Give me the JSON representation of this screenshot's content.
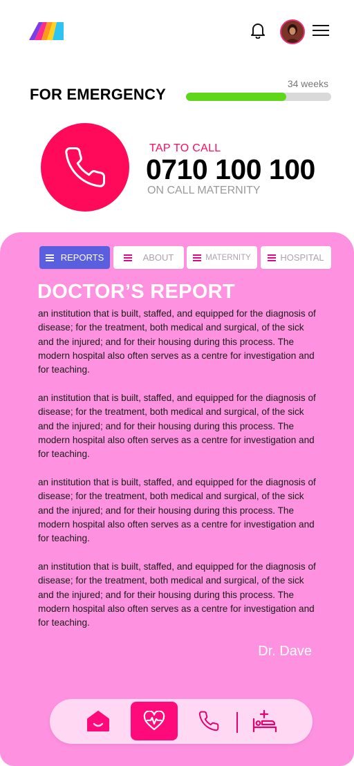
{
  "header": {
    "logo_icon": "brand-logo",
    "notification_icon": "bell-icon",
    "avatar": "user-avatar",
    "menu_icon": "hamburger-menu-icon"
  },
  "emergency": {
    "title": "FOR EMERGENCY",
    "pregnancy_progress": {
      "label": "34 weeks",
      "fraction": 0.69,
      "fill_color": "#5ed619",
      "track_color": "#d9d9d9"
    },
    "call": {
      "tap_label": "TAP TO CALL",
      "number": "0710 100 100",
      "sublabel": "ON CALL MATERNITY",
      "icon": "phone-icon",
      "button_color": "#ff0a5b"
    }
  },
  "tabs": [
    {
      "label": "REPORTS",
      "active": true
    },
    {
      "label": "ABOUT",
      "active": false
    },
    {
      "label": "MATERNITY",
      "active": false
    },
    {
      "label": "HOSPITAL",
      "active": false
    }
  ],
  "report": {
    "title": "DOCTOR’S REPORT",
    "paragraphs": [
      "an institution that is built, staffed, and equipped for the diagnosis of disease; for the treatment, both medical and surgical, of the sick and the injured; and for their housing during this process. The modern hospital also often serves as a centre for investigation and for teaching.",
      "an institution that is built, staffed, and equipped for the diagnosis of disease; for the treatment, both medical and surgical, of the sick and the injured; and for their housing during this process. The modern hospital also often serves as a centre for investigation and for teaching.",
      "an institution that is built, staffed, and equipped for the diagnosis of disease; for the treatment, both medical and surgical, of the sick and the injured; and for their housing during this process. The modern hospital also often serves as a centre for investigation and for teaching.",
      "an institution that is built, staffed, and equipped for the diagnosis of disease; for the treatment, both medical and surgical, of the sick and the injured; and for their housing during this process. The modern hospital also often serves as a centre for investigation and for teaching."
    ],
    "signature": "Dr. Dave"
  },
  "bottom_nav": {
    "items": [
      {
        "icon": "home-icon",
        "active": false
      },
      {
        "icon": "heart-pulse-icon",
        "active": true
      },
      {
        "icon": "phone-icon",
        "active": false
      },
      {
        "icon": "hospital-bed-icon",
        "active": false
      }
    ]
  },
  "colors": {
    "accent": "#ff0a5b",
    "panel": "#ff92e0",
    "tab_active": "#5a5fe0",
    "nav_bg": "#ffd9f3"
  }
}
